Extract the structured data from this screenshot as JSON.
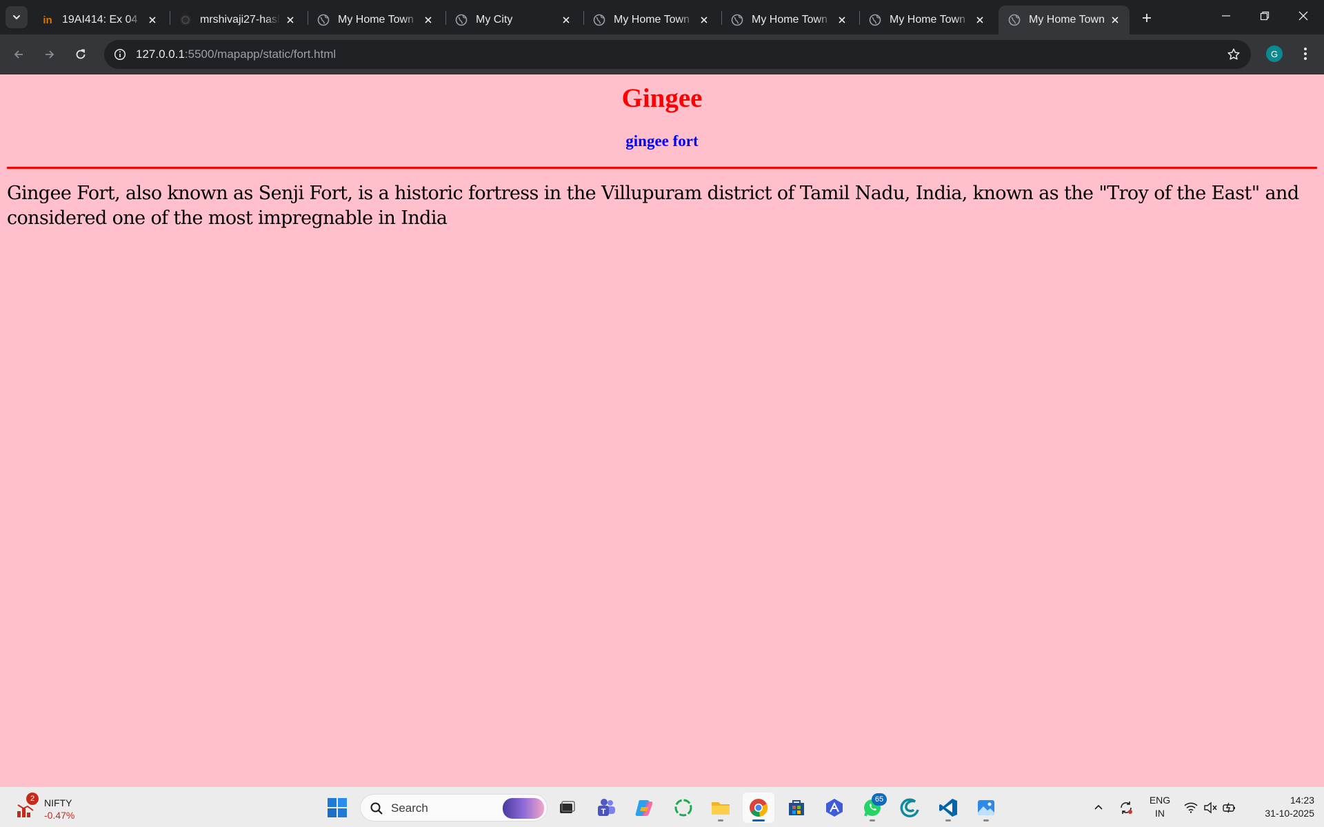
{
  "browser": {
    "tabs": [
      {
        "title": "19AI414: Ex 04 -",
        "favicon": "in-logo-icon",
        "active": false
      },
      {
        "title": "mrshivaji27-hash",
        "favicon": "github-icon",
        "active": false
      },
      {
        "title": "My Home Town",
        "favicon": "globe-icon",
        "active": false
      },
      {
        "title": "My City",
        "favicon": "globe-icon",
        "active": false
      },
      {
        "title": "My Home Town",
        "favicon": "globe-icon",
        "active": false
      },
      {
        "title": "My Home Town",
        "favicon": "globe-icon",
        "active": false
      },
      {
        "title": "My Home Town",
        "favicon": "globe-icon",
        "active": false
      },
      {
        "title": "My Home Town",
        "favicon": "globe-icon",
        "active": true
      }
    ],
    "address": {
      "host": "127.0.0.1",
      "path": ":5500/mapapp/static/fort.html"
    },
    "profile_initial": "G"
  },
  "page": {
    "title": "Gingee",
    "subtitle": "gingee fort",
    "body": "Gingee Fort, also known as Senji Fort, is a historic fortress in the Villupuram district of Tamil Nadu, India, known as the \"Troy of the East\" and considered one of the most impregnable in India",
    "colors": {
      "background": "#ffc0cb",
      "title": "#ff0000",
      "subtitle": "#0000ff",
      "rule": "#ff0000"
    }
  },
  "taskbar": {
    "widget": {
      "badge": "2",
      "name": "NIFTY",
      "change": "-0.47%"
    },
    "search_label": "Search",
    "apps": [
      {
        "name": "windows-start-icon"
      },
      {
        "name": "task-view-icon"
      },
      {
        "name": "teams-icon"
      },
      {
        "name": "copilot-icon"
      },
      {
        "name": "refresh-app-icon"
      },
      {
        "name": "file-explorer-icon",
        "open": true
      },
      {
        "name": "chrome-icon",
        "open": true,
        "active": true
      },
      {
        "name": "microsoft-store-icon"
      },
      {
        "name": "arc-icon"
      },
      {
        "name": "whatsapp-icon",
        "badge": "65",
        "open": true
      },
      {
        "name": "edge-app-icon"
      },
      {
        "name": "vscode-icon",
        "open": true
      },
      {
        "name": "photos-icon",
        "open": true
      }
    ],
    "tray": {
      "lang_top": "ENG",
      "lang_bottom": "IN",
      "time": "14:23",
      "date": "31-10-2025"
    }
  }
}
